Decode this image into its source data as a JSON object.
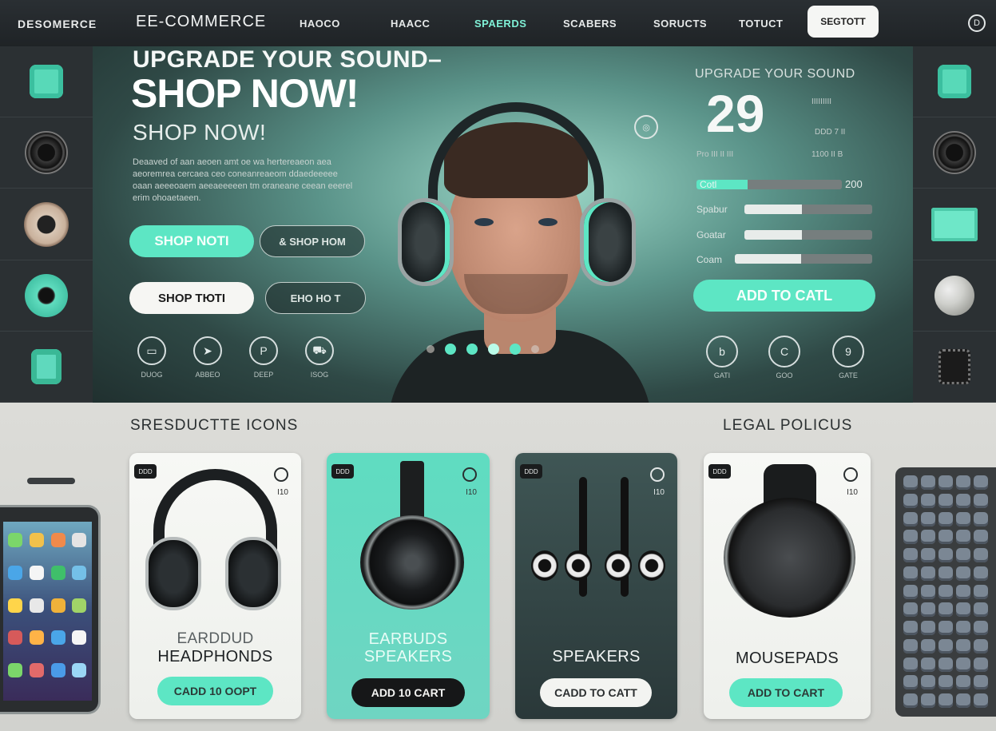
{
  "nav": {
    "brand_left": "DESOMERCE",
    "brand_main": "EE-COMMERCE",
    "links": [
      "HAOCO",
      "HAACC",
      "SPAERDS",
      "SCABERS",
      "SORUCTS",
      "TOTUCT"
    ],
    "active_index": 2,
    "button": "SEGTOTT",
    "info": "D"
  },
  "hero": {
    "title_line1": "UPGRADE YOUR SOUND–",
    "title_line2": "SHOP NOW!",
    "title_line3": "SHOP NOW!",
    "body": "Deaaved of aan aeoen amt oe wa hertereaeon aea aeoremrea cercaea ceo coneanreaeom ddaedeeeee oaan aeeeoaem aeeaeeeeen tm oraneane ceean eeerel erim ohoaetaeen.",
    "buttons": {
      "shop_primary": "SHOP NOTI",
      "shop_secondary": "& SHOP HOM",
      "shop_white": "SHOP ТЮТІ",
      "shop_outline": "ЕНО НО Т"
    },
    "icons": [
      {
        "icon": "tablet-icon",
        "label": "DUOG"
      },
      {
        "icon": "fast-icon",
        "label": "ABBEO"
      },
      {
        "icon": "p-icon",
        "label": "DEEP"
      },
      {
        "icon": "cart-icon",
        "label": "ISOG"
      }
    ],
    "dots": [
      {
        "state": "dim"
      },
      {
        "state": "on"
      },
      {
        "state": "on"
      },
      {
        "state": "glow"
      },
      {
        "state": "on"
      },
      {
        "state": "dim"
      }
    ],
    "target_icon": "◎"
  },
  "right_panel": {
    "title": "UPGRADE YOUR SOUND",
    "big_number": "29",
    "note_top": "IIIIIIIII",
    "note_mid": "DDD 7 II",
    "note_left": "Pro III II III",
    "note_bottom": "1100 II   B",
    "rows": [
      {
        "label": "Cotl",
        "value": "200",
        "fill": 0.35,
        "mint": true
      },
      {
        "label": "Spabur",
        "fill": 0.45,
        "mint": false
      },
      {
        "label": "Goatar",
        "fill": 0.45,
        "mint": false
      },
      {
        "label": "Coam",
        "fill": 0.48,
        "mint": false
      }
    ],
    "cta": "ADD TO CATL",
    "icons": [
      {
        "icon": "b-icon",
        "label": "GATI"
      },
      {
        "icon": "c-icon",
        "label": "GOO"
      },
      {
        "icon": "g-icon",
        "label": "GATE"
      }
    ]
  },
  "sections": {
    "left_title": "SRESDUCTTE ICONS",
    "right_title": "LEGAL POLICUS"
  },
  "cards": [
    {
      "tag": "DDD",
      "num": "I10",
      "title1": "EARDDUD",
      "title2": "HEADPHONDS",
      "button": "CADD 10 OOPT",
      "style": "light",
      "btn_style": "b-mint"
    },
    {
      "tag": "DDD",
      "num": "I10",
      "title1": "EARBUDS",
      "title2": "SPEAKERS",
      "button": "ADD 10 CART",
      "style": "mint",
      "btn_style": "b-black"
    },
    {
      "tag": "DDD",
      "num": "I10",
      "title1": "",
      "title2": "SPEAKERS",
      "button": "CADD TO CATT",
      "style": "dark",
      "btn_style": "b-white"
    },
    {
      "tag": "DDD",
      "num": "I10",
      "title1": "",
      "title2": "MOUSEPADS",
      "button": "ADD TO CART",
      "style": "light",
      "btn_style": "b-mint"
    }
  ],
  "colors": {
    "accent": "#5de6c4",
    "dark": "#2b3033",
    "light": "#f5f6f4"
  }
}
